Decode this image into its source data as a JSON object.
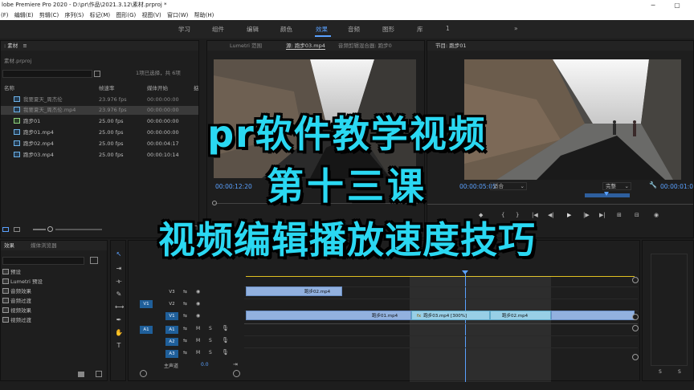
{
  "window": {
    "title": "lobe Premiere Pro 2020 - D:\\pr\\作品\\2021.3.12\\素材.prproj *",
    "minimize": "─",
    "maximize": "▢"
  },
  "menu": [
    "(F)",
    "编辑(E)",
    "剪辑(C)",
    "序列(S)",
    "标记(M)",
    "图形(G)",
    "视图(V)",
    "窗口(W)",
    "帮助(H)"
  ],
  "workspaces": [
    {
      "label": "学习"
    },
    {
      "label": "组件"
    },
    {
      "label": "编辑"
    },
    {
      "label": "颜色"
    },
    {
      "label": "效果",
      "active": true
    },
    {
      "label": "音频"
    },
    {
      "label": "图形"
    },
    {
      "label": "库"
    },
    {
      "label": "1"
    },
    {
      "label": "»"
    }
  ],
  "project": {
    "tab": ": 素材",
    "menu_icon": "≡",
    "file": "素材.prproj",
    "selection": "1项已选择，共 6项",
    "columns": {
      "name": "名称",
      "fps": "帧速率",
      "start": "媒体开始",
      "extra": "掂"
    },
    "items": [
      {
        "name": "我要夏天_周杰伦",
        "fps": "23.976 fps",
        "start": "00:00:00:00",
        "type": "video"
      },
      {
        "name": "我要夏天_周杰伦.mp4",
        "fps": "23.976 fps",
        "start": "00:00:00:00",
        "type": "video",
        "selected": true
      },
      {
        "name": "跑步01",
        "fps": "25.00 fps",
        "start": "00:00:00:00",
        "type": "audio"
      },
      {
        "name": "跑步01.mp4",
        "fps": "25.00 fps",
        "start": "00:00:00:00",
        "type": "video"
      },
      {
        "name": "跑步02.mp4",
        "fps": "25.00 fps",
        "start": "00:00:04:17",
        "type": "video"
      },
      {
        "name": "跑步03.mp4",
        "fps": "25.00 fps",
        "start": "00:00:10:14",
        "type": "video"
      }
    ]
  },
  "effects": {
    "tab": "效果",
    "tab2": "媒体浏览器",
    "items": [
      "预设",
      "Lumetri 预设",
      "音频效果",
      "音频过渡",
      "视频效果",
      "视频过渡"
    ]
  },
  "source_monitor": {
    "tabs": [
      "Lumetri 范围",
      "源: 跑步03.mp4",
      "音频剪辑混合器: 跑步0"
    ],
    "timecode": "00:00:12:20"
  },
  "program_monitor": {
    "tab": "节目: 跑步01",
    "timecode": "00:00:05:05",
    "fit": "适合",
    "quality": "完整",
    "end_timecode": "00:00:01:0",
    "buttons": [
      "◆",
      "{",
      "}",
      "|◀",
      "◀|",
      "▶",
      "|▶",
      "▶|",
      "⊞",
      "⊟",
      "◉"
    ]
  },
  "timeline": {
    "video_tracks": [
      "V3",
      "V2",
      "V1"
    ],
    "audio_tracks": [
      "A1",
      "A2",
      "A3"
    ],
    "source_v": "V1",
    "source_a": "A1",
    "master": "主声道",
    "master_value": "0.0",
    "clips": [
      {
        "label": "跑步02.mp4",
        "track": "V3"
      },
      {
        "label": "跑步01.mp4",
        "track": "V1"
      },
      {
        "label": "跑步03.mp4 [300%]",
        "track": "V1",
        "fx": "fx"
      },
      {
        "label": "跑步02.mp4",
        "track": "V1"
      }
    ],
    "meter_labels": [
      "S",
      "S"
    ]
  },
  "overlay": {
    "line1": "pr软件教学视频",
    "line2": "第十三课",
    "line3": "视频编辑播放速度技巧"
  },
  "colors": {
    "accent": "#5aa1ff",
    "overlay_text": "#2ad8f2",
    "clip_video": "#92b1df",
    "clip_selected": "#98cfe6"
  }
}
